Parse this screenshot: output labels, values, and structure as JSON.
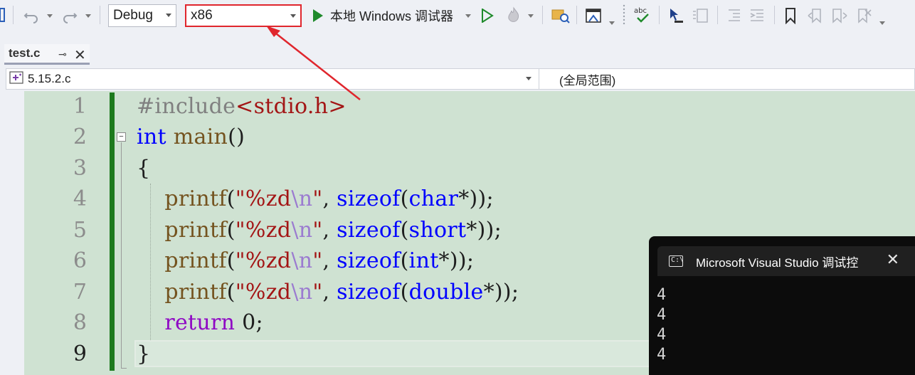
{
  "toolbar": {
    "configuration": "Debug",
    "platform": "x86",
    "run_label": "本地 Windows 调试器"
  },
  "tab": {
    "title": "test.c",
    "pin_glyph": "⊸",
    "close_glyph": "✕"
  },
  "navbar": {
    "file": "5.15.2.c",
    "scope": "(全局范围)"
  },
  "editor": {
    "line_numbers": [
      "1",
      "2",
      "3",
      "4",
      "5",
      "6",
      "7",
      "8",
      "9"
    ],
    "active_line": "9",
    "fold_glyph": "−",
    "lines": [
      [
        {
          "t": "#include",
          "c": "pp"
        },
        {
          "t": "<stdio.h>",
          "c": "inc"
        }
      ],
      [
        {
          "t": "int",
          "c": "kw"
        },
        {
          "t": " "
        },
        {
          "t": "main",
          "c": "fn"
        },
        {
          "t": "()"
        }
      ],
      [
        {
          "t": "{"
        }
      ],
      [
        {
          "t": "    "
        },
        {
          "t": "printf",
          "c": "fn"
        },
        {
          "t": "("
        },
        {
          "t": "\"%zd",
          "c": "str"
        },
        {
          "t": "\\n",
          "c": "esc"
        },
        {
          "t": "\"",
          "c": "str"
        },
        {
          "t": ", "
        },
        {
          "t": "sizeof",
          "c": "kw"
        },
        {
          "t": "("
        },
        {
          "t": "char",
          "c": "kw"
        },
        {
          "t": "*));"
        }
      ],
      [
        {
          "t": "    "
        },
        {
          "t": "printf",
          "c": "fn"
        },
        {
          "t": "("
        },
        {
          "t": "\"%zd",
          "c": "str"
        },
        {
          "t": "\\n",
          "c": "esc"
        },
        {
          "t": "\"",
          "c": "str"
        },
        {
          "t": ", "
        },
        {
          "t": "sizeof",
          "c": "kw"
        },
        {
          "t": "("
        },
        {
          "t": "short",
          "c": "kw"
        },
        {
          "t": "*));"
        }
      ],
      [
        {
          "t": "    "
        },
        {
          "t": "printf",
          "c": "fn"
        },
        {
          "t": "("
        },
        {
          "t": "\"%zd",
          "c": "str"
        },
        {
          "t": "\\n",
          "c": "esc"
        },
        {
          "t": "\"",
          "c": "str"
        },
        {
          "t": ", "
        },
        {
          "t": "sizeof",
          "c": "kw"
        },
        {
          "t": "("
        },
        {
          "t": "int",
          "c": "kw"
        },
        {
          "t": "*));"
        }
      ],
      [
        {
          "t": "    "
        },
        {
          "t": "printf",
          "c": "fn"
        },
        {
          "t": "("
        },
        {
          "t": "\"%zd",
          "c": "str"
        },
        {
          "t": "\\n",
          "c": "esc"
        },
        {
          "t": "\"",
          "c": "str"
        },
        {
          "t": ", "
        },
        {
          "t": "sizeof",
          "c": "kw"
        },
        {
          "t": "("
        },
        {
          "t": "double",
          "c": "kw"
        },
        {
          "t": "*));"
        }
      ],
      [
        {
          "t": "    "
        },
        {
          "t": "return",
          "c": "rk"
        },
        {
          "t": " "
        },
        {
          "t": "0",
          "c": "num"
        },
        {
          "t": ";"
        }
      ],
      [
        {
          "t": "}"
        }
      ]
    ]
  },
  "console": {
    "title": "Microsoft Visual Studio 调试控",
    "icon_text": "C:\\",
    "close_glyph": "✕",
    "output": [
      "4",
      "4",
      "4",
      "4"
    ]
  },
  "colors": {
    "annotation_red": "#e0262d",
    "change_bar_green": "#1d7a1d",
    "editor_bg": "#cfe2d2"
  }
}
